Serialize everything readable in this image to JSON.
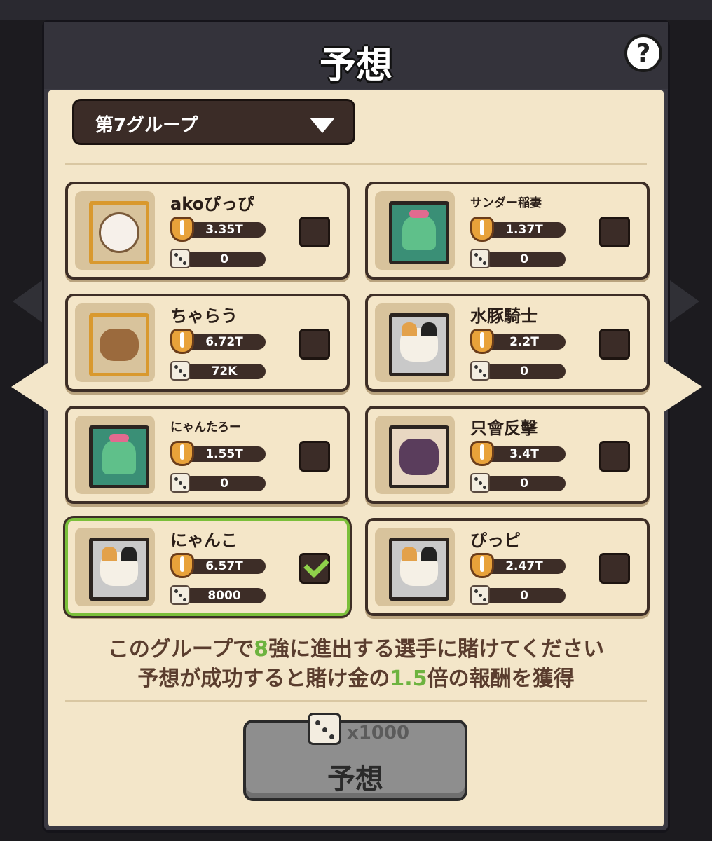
{
  "header": {
    "title": "予想",
    "help_label": "?"
  },
  "group_select": {
    "selected": "第7グループ"
  },
  "players": [
    {
      "name": "akoぴっぴ",
      "power": "3.35T",
      "bet": "0",
      "selected": false,
      "avatar": "hero-avatar",
      "name_size": "large"
    },
    {
      "name": "サンダー稲妻",
      "power": "1.37T",
      "bet": "0",
      "selected": false,
      "avatar": "cactus-avatar",
      "name_size": "small"
    },
    {
      "name": "ちゃらう",
      "power": "6.72T",
      "bet": "72K",
      "selected": false,
      "avatar": "capybara-avatar",
      "name_size": "large"
    },
    {
      "name": "水豚騎士",
      "power": "2.2T",
      "bet": "0",
      "selected": false,
      "avatar": "cat-avatar",
      "name_size": "large"
    },
    {
      "name": "にゃんたろー",
      "power": "1.55T",
      "bet": "0",
      "selected": false,
      "avatar": "cactus-avatar",
      "name_size": "small"
    },
    {
      "name": "只會反擊",
      "power": "3.4T",
      "bet": "0",
      "selected": false,
      "avatar": "masked-avatar",
      "name_size": "large"
    },
    {
      "name": "にゃんこ",
      "power": "6.57T",
      "bet": "8000",
      "selected": true,
      "avatar": "cat-avatar",
      "name_size": "large"
    },
    {
      "name": "ぴっピ",
      "power": "2.47T",
      "bet": "0",
      "selected": false,
      "avatar": "cat-avatar",
      "name_size": "large"
    }
  ],
  "info": {
    "line1_a": "このグループで",
    "line1_hl": "8",
    "line1_b": "強に進出する選手に賭けてください",
    "line2_a": "予想が成功すると賭け金の",
    "line2_hl": "1.5",
    "line2_b": "倍の報酬を獲得"
  },
  "predict_button": {
    "label": "予想",
    "cost": "x1000"
  },
  "colors": {
    "accent_green": "#6db33f",
    "panel_bg": "#f3e6c9",
    "dark_brown": "#3b2c27"
  }
}
